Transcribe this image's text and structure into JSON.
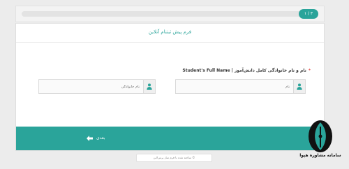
{
  "progress": {
    "step_label": "۱ / ۳",
    "fraction": 0.0
  },
  "form": {
    "title": "فرم پیش ثبتنام آنلاین",
    "field_label": "نام و نام خانوادگی کامل دانش‌آموز | Student's Full Name",
    "required_mark": "*",
    "first_name": {
      "placeholder": "نام",
      "value": ""
    },
    "last_name": {
      "placeholder": "نام خانوادگی",
      "value": ""
    },
    "submit_label": "بعدی",
    "footer": "© ساخته شده با فرم ساز پرس‌لاین"
  },
  "watermark": {
    "text": "سامانه مشاوره هپوا"
  },
  "icons": {
    "user": "user-icon",
    "next": "arrow-icon"
  },
  "colors": {
    "accent": "#2aa49a",
    "required": "#e53935"
  }
}
